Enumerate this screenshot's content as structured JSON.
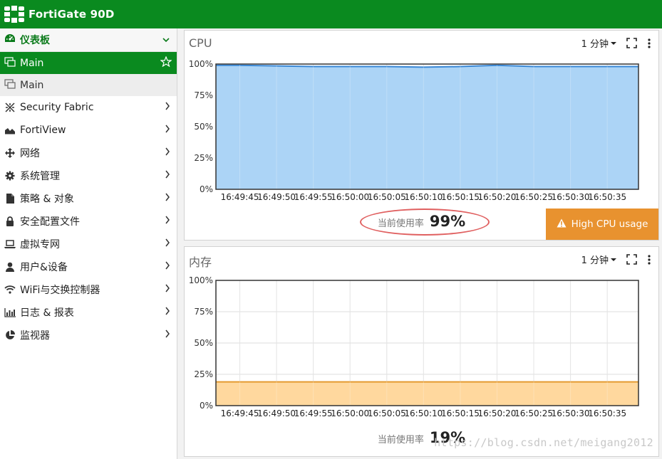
{
  "header": {
    "product_name": "FortiGate 90D",
    "brand_color": "#0a8a1f",
    "logo": "fortinet-logo-icon"
  },
  "sidebar": {
    "section": {
      "label": "仪表板",
      "icon": "dashboard-icon",
      "expanded": true
    },
    "active_item": {
      "label": "Main",
      "icon": "monitor-icon",
      "favorite": "star-icon"
    },
    "sub_item": {
      "label": "Main",
      "icon": "monitor-icon"
    },
    "items": [
      {
        "label": "Security Fabric",
        "icon": "fabric-icon"
      },
      {
        "label": "FortiView",
        "icon": "area-chart-icon"
      },
      {
        "label": "网络",
        "icon": "network-arrows-icon"
      },
      {
        "label": "系统管理",
        "icon": "gear-icon"
      },
      {
        "label": "策略 & 对象",
        "icon": "document-icon"
      },
      {
        "label": "安全配置文件",
        "icon": "lock-icon"
      },
      {
        "label": "虚拟专网",
        "icon": "laptop-icon"
      },
      {
        "label": "用户&设备",
        "icon": "user-icon"
      },
      {
        "label": "WiFi与交换控制器",
        "icon": "wifi-icon"
      },
      {
        "label": "日志 & 报表",
        "icon": "bar-chart-icon"
      },
      {
        "label": "监视器",
        "icon": "pie-chart-icon"
      }
    ]
  },
  "cpu_panel": {
    "title": "CPU",
    "interval": "1 分钟",
    "usage_label": "当前使用率",
    "usage_value": "99%",
    "alert": "High CPU usage",
    "fill_color": "#a8d2f5",
    "line_color": "#3a88d6",
    "alert_color": "#e8922f"
  },
  "mem_panel": {
    "title": "内存",
    "interval": "1 分钟",
    "usage_label": "当前使用率",
    "usage_value": "19%",
    "fill_color": "#ffd699",
    "line_color": "#e49a30"
  },
  "chart_data": [
    {
      "type": "area",
      "title": "CPU",
      "ylim": [
        0,
        100
      ],
      "y_ticks": [
        "0%",
        "25%",
        "50%",
        "75%",
        "100%"
      ],
      "categories": [
        "16:49:45",
        "16:49:50",
        "16:49:55",
        "16:50:00",
        "16:50:05",
        "16:50:10",
        "16:50:15",
        "16:50:20",
        "16:50:25",
        "16:50:30",
        "16:50:35"
      ],
      "values": [
        99,
        98.5,
        98,
        98,
        98,
        97.5,
        98,
        99,
        98,
        98,
        98
      ],
      "grid": true
    },
    {
      "type": "area",
      "title": "内存",
      "ylim": [
        0,
        100
      ],
      "y_ticks": [
        "0%",
        "25%",
        "50%",
        "75%",
        "100%"
      ],
      "categories": [
        "16:49:45",
        "16:49:50",
        "16:49:55",
        "16:50:00",
        "16:50:05",
        "16:50:10",
        "16:50:15",
        "16:50:20",
        "16:50:25",
        "16:50:30",
        "16:50:35"
      ],
      "values": [
        19,
        19,
        19,
        19,
        19,
        19,
        19,
        19,
        19,
        19,
        19
      ],
      "grid": true
    }
  ],
  "watermark": "https://blog.csdn.net/meigang2012"
}
